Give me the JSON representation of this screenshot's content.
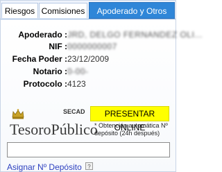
{
  "tabs": [
    {
      "label": "Riesgos"
    },
    {
      "label": "Comisiones"
    },
    {
      "label": "Apoderado y Otros"
    }
  ],
  "fields": [
    {
      "label": "Apoderado :",
      "value": "JRD, DELGO FERNANDEZ OLI..."
    },
    {
      "label": "NIF :",
      "value": "0000000007"
    },
    {
      "label": "Fecha Poder :",
      "value": "23/12/2009"
    },
    {
      "label": "Notario :",
      "value": "0-00-"
    },
    {
      "label": "Protocolo :",
      "value": "4123"
    }
  ],
  "logo": {
    "brand": "TesoroPúblico",
    "secad": "SECAD",
    "icon": "crown-icon"
  },
  "actions": {
    "presentar_online": "PRESENTAR ONLINE",
    "note": "* Obtención automática Nº depósito (24h después)",
    "input_value": "",
    "asignar_link": "Asignar Nº Depósito",
    "help_glyph": "?"
  },
  "colors": {
    "active_tab": "#2f86d8",
    "online_button": "#ffff00",
    "link": "#2c3fbf"
  }
}
